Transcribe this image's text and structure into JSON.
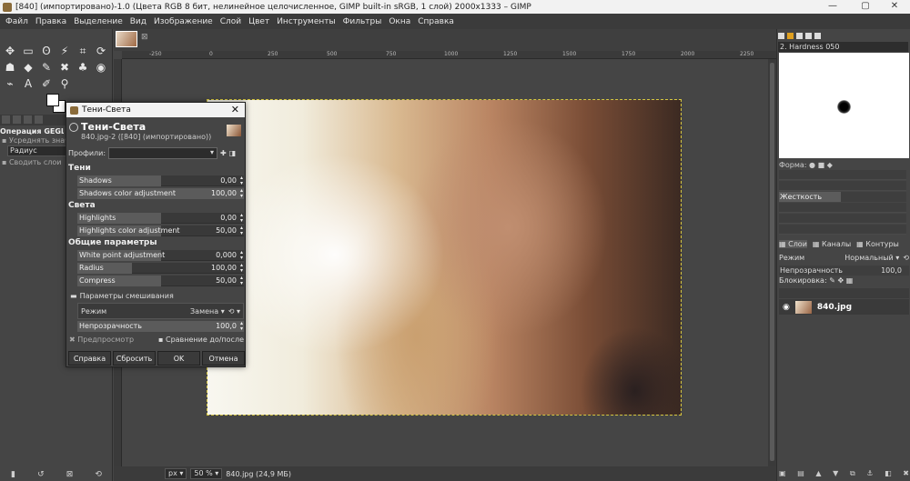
{
  "window": {
    "title": "[840] (импортировано)-1.0 (Цвета RGB 8 бит, нелинейное целочисленное, GIMP built-in sRGB, 1 слой) 2000x1333 – GIMP",
    "minimize": "—",
    "maximize": "▢",
    "close": "✕"
  },
  "menu": [
    "Файл",
    "Правка",
    "Выделение",
    "Вид",
    "Изображение",
    "Слой",
    "Цвет",
    "Инструменты",
    "Фильтры",
    "Окна",
    "Справка"
  ],
  "toolbox": {
    "tool_options_title": "Операция GEGL",
    "opt_sample_merged": "Усреднять значен",
    "opt_radius": "Радиус",
    "opt_sample_layers": "Сводить слои"
  },
  "ruler_ticks": [
    "-250",
    "0",
    "250",
    "500",
    "750",
    "1000",
    "1250",
    "1500",
    "1750",
    "2000",
    "2250"
  ],
  "statusbar": {
    "unit": "px",
    "zoom": "50 %",
    "file_info": "840.jpg (24,9 МБ)"
  },
  "dialog": {
    "title": "Тени-Света",
    "name": "Тени-Света",
    "subtitle": "840.jpg-2 ([840] (импортировано))",
    "profiles_label": "Профили:",
    "section_shadows": "Тени",
    "shadows_label": "Shadows",
    "shadows_value": "0,00",
    "shadows_fill": 0.5,
    "shadows_color_label": "Shadows color adjustment",
    "shadows_color_value": "100,00",
    "shadows_color_fill": 1.0,
    "section_highlights": "Света",
    "highlights_label": "Highlights",
    "highlights_value": "0,00",
    "highlights_fill": 0.5,
    "highlights_color_label": "Highlights color adjustment",
    "highlights_color_value": "50,00",
    "highlights_color_fill": 0.5,
    "section_common": "Общие параметры",
    "whitepoint_label": "White point adjustment",
    "whitepoint_value": "0,000",
    "whitepoint_fill": 0.5,
    "radius_label": "Radius",
    "radius_value": "100,00",
    "radius_fill": 0.33,
    "compress_label": "Compress",
    "compress_value": "50,00",
    "compress_fill": 0.5,
    "blend_header": "Параметры смешивания",
    "mode_label": "Режим",
    "mode_value": "Замена",
    "opacity_label": "Непрозрачность",
    "opacity_value": "100,0",
    "opacity_fill": 1.0,
    "preview_label": "Предпросмотр",
    "compare_label": "Сравнение до/после",
    "btn_help": "Справка",
    "btn_reset": "Сбросить",
    "btn_ok": "OK",
    "btn_cancel": "Отмена"
  },
  "right_panel": {
    "brush_name": "2. Hardness 050",
    "shape_label": "Форма:",
    "hardness_label": "Жесткость",
    "layers_tab": "Слои",
    "channels_tab": "Каналы",
    "paths_tab": "Контуры",
    "mode_label": "Режим",
    "mode_value": "Нормальный",
    "opacity_label": "Непрозрачность",
    "opacity_value": "100,0",
    "lock_label": "Блокировка:",
    "layer_name": "840.jpg"
  }
}
